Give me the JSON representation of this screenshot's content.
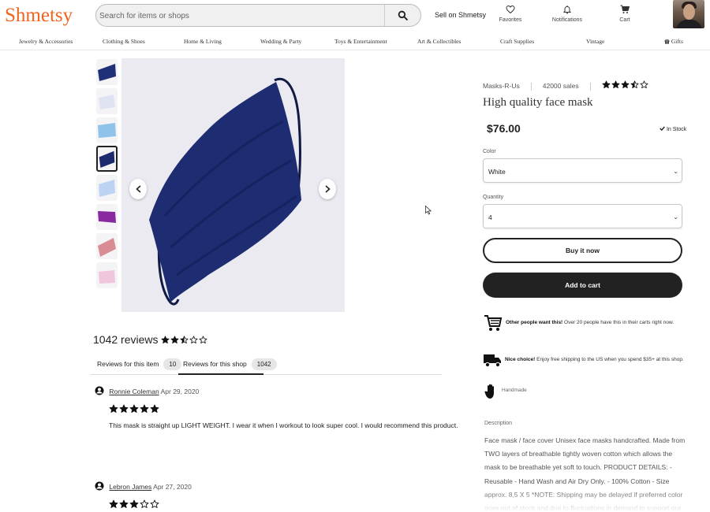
{
  "header": {
    "logo": "Shmetsy",
    "search_placeholder": "Search for items or shops",
    "sell_label": "Sell on Shmetsy",
    "favorites_label": "Favorites",
    "notifications_label": "Notifications",
    "cart_label": "Cart"
  },
  "categories": [
    "Jewelry & Accessories",
    "Clothing & Shoes",
    "Home & Living",
    "Wedding & Party",
    "Toys & Entertainment",
    "Art & Collectibles",
    "Craft Supplies",
    "Vintage",
    "Gifts"
  ],
  "gallery": {
    "thumbnails": [
      {
        "color": "#1f2f78"
      },
      {
        "color": "#dfe3f2"
      },
      {
        "color": "#8fc3ea"
      },
      {
        "color": "#1d2a6e"
      },
      {
        "color": "#bcd4f2"
      },
      {
        "color": "#8a2aa0"
      },
      {
        "color": "#d98c94"
      },
      {
        "color": "#efc6dc"
      }
    ],
    "selected_index": 3,
    "main_color": "#1e2c72"
  },
  "reviews": {
    "count_label": "1042 reviews",
    "rating": 2.5,
    "tabs": [
      {
        "label": "Reviews for this item",
        "count": "10"
      },
      {
        "label": "Reviews for this shop",
        "count": "1042"
      }
    ],
    "active_tab": 1,
    "items": [
      {
        "user": "Ronnie Coleman",
        "date": "Apr 29, 2020",
        "stars": 5,
        "text": "This mask is straight up LIGHT WEIGHT. I wear it when I workout to look super cool. I would recommend this product."
      },
      {
        "user": "Lebron James",
        "date": "Apr 27, 2020",
        "stars": 3,
        "text": ""
      }
    ]
  },
  "product": {
    "shop": "Masks-R-Us",
    "sales": "42000 sales",
    "rating": 3.5,
    "title": "High quality face mask",
    "price": "$76.00",
    "stock": "In Stock",
    "color_label": "Color",
    "color_value": "White",
    "quantity_label": "Quantity",
    "quantity_value": "4",
    "buy_label": "Buy it now",
    "cart_label": "Add to cart",
    "perks": [
      {
        "bold": "Other people want this!",
        "text": " Over 20 people have this in their carts right now."
      },
      {
        "bold": "Nice choice!",
        "text": " Enjoy free shipping to the US when you spend $35+ at this shop."
      },
      {
        "bold": "",
        "text": "Handmade"
      }
    ],
    "description_label": "Description",
    "description": "Face mask / face cover Unisex face masks handcrafted. Made from TWO layers of breathable tightly woven cotton which allows the mask to be breathable yet soft to touch. PRODUCT DETAILS: - Reusable - Hand Wash and Air Dry Only. - 100% Cotton - Size approx. 8,5 X 5 *NOTE: Shipping may be delayed if preferred color goes out of stock and due to fluctuations in demand to support our local healthcare and law enforcement. PLEASE"
  }
}
